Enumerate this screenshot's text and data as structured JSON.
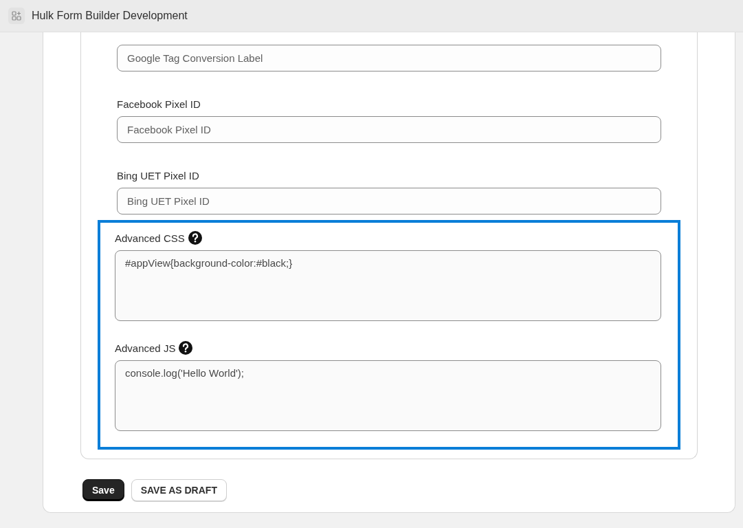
{
  "app": {
    "title": "Hulk Form Builder Development"
  },
  "fields": [
    {
      "kind": "input",
      "placeholder": "Google Tag Conversion Label",
      "help": false
    },
    {
      "label": "Facebook Pixel ID",
      "kind": "input",
      "placeholder": "Facebook Pixel ID",
      "help": false
    },
    {
      "label": "Bing UET Pixel ID",
      "kind": "input",
      "placeholder": "Bing UET Pixel ID",
      "help": false
    }
  ],
  "highlighted_fields": [
    {
      "label": "Advanced CSS",
      "kind": "code",
      "value": "#appView{background-color:#black;}",
      "help": true
    },
    {
      "label": "Advanced JS",
      "kind": "code",
      "value": "console.log('Hello World');",
      "help": true
    }
  ],
  "buttons": [
    {
      "label": "Save",
      "kind": "primary"
    },
    {
      "label": "SAVE AS DRAFT",
      "kind": "secondary"
    }
  ]
}
